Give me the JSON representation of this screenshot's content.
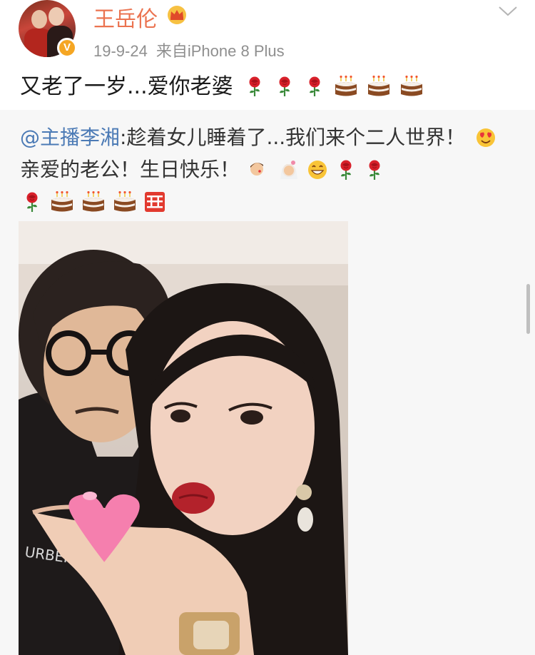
{
  "post": {
    "author": "王岳伦",
    "date": "19-9-24",
    "source_prefix": "来自",
    "device": "iPhone 8 Plus",
    "verified_badge": "V",
    "text": "又老了一岁...爱你老婆",
    "emojis": [
      "rose-icon",
      "rose-icon",
      "rose-icon",
      "cake-icon",
      "cake-icon",
      "cake-icon"
    ]
  },
  "repost": {
    "mention": "@主播李湘",
    "text_part1": ":趁着女儿睡着了...我们来个二人世界！",
    "text_part2": "亲爱的老公！生日快乐！",
    "line3_emojis": [
      "rose-icon",
      "cake-icon",
      "cake-icon",
      "cake-icon",
      "double-happiness-icon"
    ]
  },
  "colors": {
    "username": "#eb7350",
    "mention": "#4b7ab5",
    "meta": "#8f8f8f",
    "repost_bg": "#f7f7f7"
  }
}
